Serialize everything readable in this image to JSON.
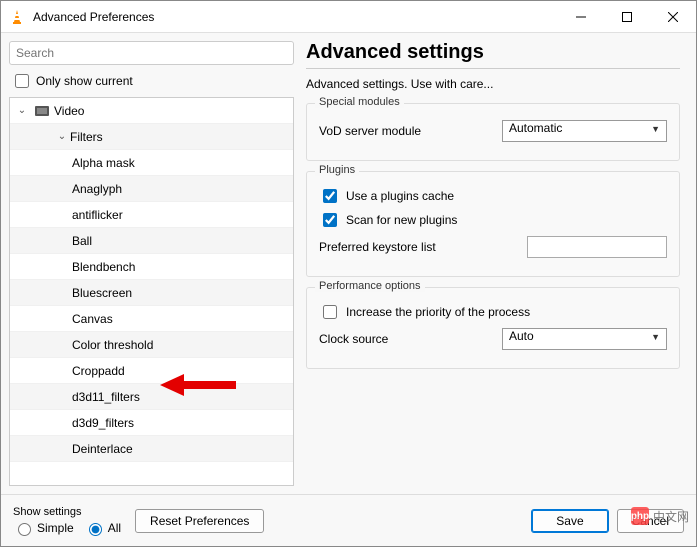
{
  "window": {
    "title": "Advanced Preferences"
  },
  "search": {
    "placeholder": "Search"
  },
  "only_show_current": {
    "label": "Only show current",
    "checked": false
  },
  "tree": {
    "root": {
      "label": "Video",
      "expanded": true
    },
    "filters_node": {
      "label": "Filters",
      "expanded": true
    },
    "items": [
      "Alpha mask",
      "Anaglyph",
      "antiflicker",
      "Ball",
      "Blendbench",
      "Bluescreen",
      "Canvas",
      "Color threshold",
      "Croppadd",
      "d3d11_filters",
      "d3d9_filters",
      "Deinterlace"
    ]
  },
  "right": {
    "title": "Advanced settings",
    "subtitle": "Advanced settings. Use with care...",
    "groups": {
      "special": {
        "title": "Special modules",
        "vod_label": "VoD server module",
        "vod_value": "Automatic"
      },
      "plugins": {
        "title": "Plugins",
        "use_cache": {
          "label": "Use a plugins cache",
          "checked": true
        },
        "scan_new": {
          "label": "Scan for new plugins",
          "checked": true
        },
        "keystore_label": "Preferred keystore list",
        "keystore_value": ""
      },
      "perf": {
        "title": "Performance options",
        "increase_priority": {
          "label": "Increase the priority of the process",
          "checked": false
        },
        "clock_label": "Clock source",
        "clock_value": "Auto"
      }
    }
  },
  "footer": {
    "show_settings_label": "Show settings",
    "simple_label": "Simple",
    "all_label": "All",
    "reset_label": "Reset Preferences",
    "save_label": "Save",
    "cancel_label": "Cancel"
  },
  "watermark": {
    "text": "中文网",
    "prefix": "php"
  }
}
